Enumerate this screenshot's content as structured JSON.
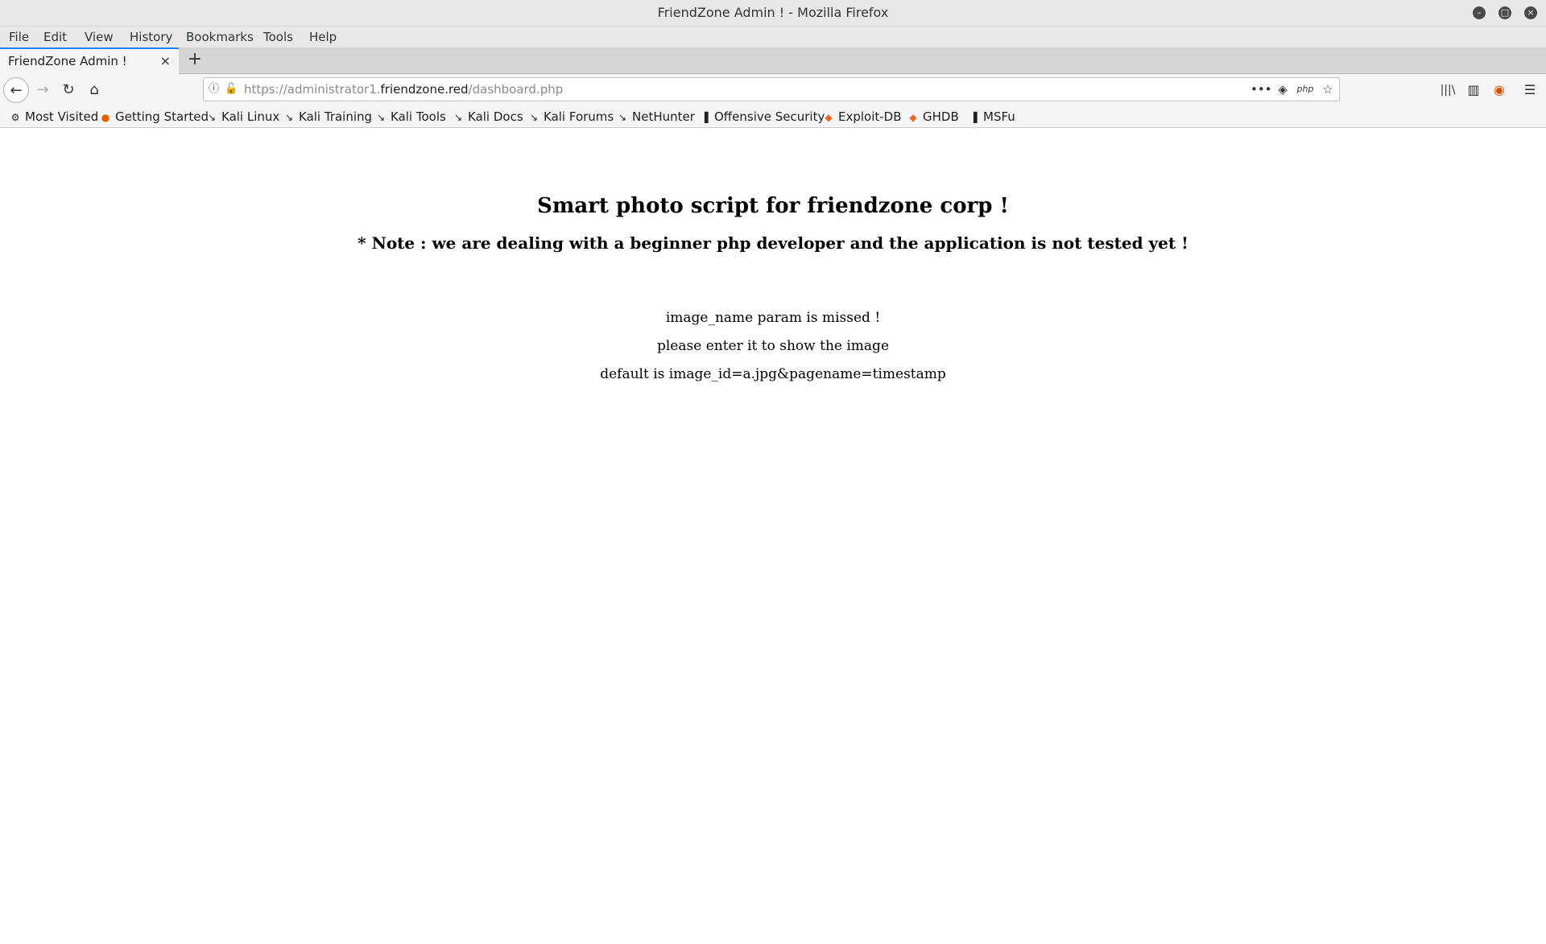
{
  "window": {
    "title": "FriendZone Admin ! - Mozilla Firefox",
    "controls": {
      "minimize": "–",
      "maximize": "□",
      "close": "×"
    }
  },
  "menu": [
    "File",
    "Edit",
    "View",
    "History",
    "Bookmarks",
    "Tools",
    "Help"
  ],
  "tab": {
    "label": "FriendZone Admin !",
    "close": "×",
    "new_tab": "+"
  },
  "navigation": {
    "back": "←",
    "forward": "→",
    "reload": "↻",
    "home": "⌂",
    "url_prefix": "https://administrator1.",
    "url_host": "friendzone.red",
    "url_path": "/dashboard.php",
    "page_actions": {
      "more": "•••",
      "pocket": "◈",
      "php": "php",
      "bookmark": "☆"
    },
    "toolbar": {
      "library": "|||\\",
      "sidebar": "▥",
      "extension": "◉",
      "menu": "☰"
    }
  },
  "bookmarks": [
    {
      "label": "Most Visited",
      "icon": "gear-icon",
      "glyph": "⚙"
    },
    {
      "label": "Getting Started",
      "icon": "firefox-icon",
      "glyph": "●"
    },
    {
      "label": "Kali Linux",
      "icon": "kali-icon",
      "glyph": "↘"
    },
    {
      "label": "Kali Training",
      "icon": "kali-icon",
      "glyph": "↘"
    },
    {
      "label": "Kali Tools",
      "icon": "kali-icon",
      "glyph": "↘"
    },
    {
      "label": "Kali Docs",
      "icon": "kali-icon",
      "glyph": "↘"
    },
    {
      "label": "Kali Forums",
      "icon": "kali-icon",
      "glyph": "↘"
    },
    {
      "label": "NetHunter",
      "icon": "kali-icon",
      "glyph": "↘"
    },
    {
      "label": "Offensive Security",
      "icon": "offsec-icon",
      "glyph": "▐"
    },
    {
      "label": "Exploit-DB",
      "icon": "exploitdb-icon",
      "glyph": "◆"
    },
    {
      "label": "GHDB",
      "icon": "ghdb-icon",
      "glyph": "◆"
    },
    {
      "label": "MSFu",
      "icon": "msfu-icon",
      "glyph": "▐"
    }
  ],
  "page": {
    "heading": "Smart photo script for friendzone corp !",
    "note": "* Note : we are dealing with a beginner php developer and the application is not tested yet !",
    "lines": [
      "image_name param is missed !",
      "please enter it to show the image",
      "default is image_id=a.jpg&pagename=timestamp"
    ]
  },
  "colors": {
    "accent": "#0a84ff",
    "chrome": "#e8e8e7",
    "toolbar": "#f5f5f5"
  }
}
